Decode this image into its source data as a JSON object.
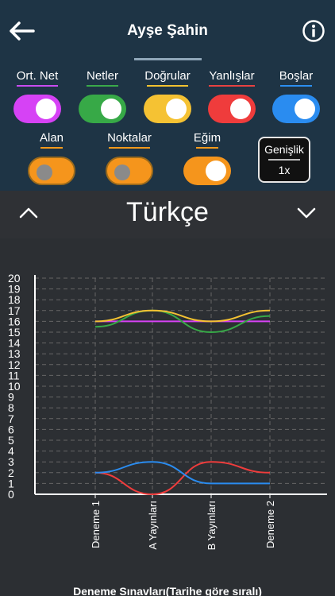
{
  "header": {
    "title": "Ayşe Şahin"
  },
  "toggles_row1": [
    {
      "label": "Ort. Net",
      "underline": "#c94cf0",
      "color": "#d642f5",
      "state": "on"
    },
    {
      "label": "Netler",
      "underline": "#3aa94a",
      "color": "#37a947",
      "state": "on"
    },
    {
      "label": "Doğrular",
      "underline": "#f2c230",
      "color": "#f5c233",
      "state": "on"
    },
    {
      "label": "Yanlışlar",
      "underline": "#e84141",
      "color": "#ef3c3c",
      "state": "on"
    },
    {
      "label": "Boşlar",
      "underline": "#2b8ef0",
      "color": "#2a8cf0",
      "state": "on"
    }
  ],
  "toggles_row2": [
    {
      "label": "Alan",
      "underline": "#f29a1c",
      "color": "#f5951c",
      "state": "off"
    },
    {
      "label": "Noktalar",
      "underline": "#f29a1c",
      "color": "#f5951c",
      "state": "off"
    },
    {
      "label": "Eğim",
      "underline": "#f29a1c",
      "color": "#f5951c",
      "state": "on"
    }
  ],
  "width_control": {
    "label": "Genişlik",
    "value": "1x"
  },
  "subject": {
    "title": "Türkçe"
  },
  "chart_data": {
    "type": "line",
    "categories": [
      "Deneme 1",
      "A Yayınları",
      "B Yayınları",
      "Deneme 2"
    ],
    "xlabel": "Deneme Sınavları(Tarihe göre sıralı)",
    "ylim": [
      0,
      20
    ],
    "yticks": [
      "0",
      "1",
      "2",
      "3",
      "4",
      "5",
      "6",
      "7",
      "8",
      "9",
      "10",
      "11",
      "12",
      "13",
      "14",
      "15",
      "16",
      "17",
      "18",
      "19",
      "20"
    ],
    "grid": true,
    "series": [
      {
        "key": "ort_net",
        "color": "#d642f5",
        "values": [
          16,
          16,
          16,
          16
        ]
      },
      {
        "key": "netler",
        "color": "#37a947",
        "values": [
          15.5,
          17,
          15,
          16.5
        ]
      },
      {
        "key": "dogrular",
        "color": "#f5c233",
        "values": [
          16,
          17,
          16,
          17
        ]
      },
      {
        "key": "yanlislar",
        "color": "#ef3c3c",
        "values": [
          2,
          0,
          3,
          2
        ]
      },
      {
        "key": "boslar",
        "color": "#2a8cf0",
        "values": [
          2,
          3,
          1,
          1
        ]
      }
    ]
  }
}
